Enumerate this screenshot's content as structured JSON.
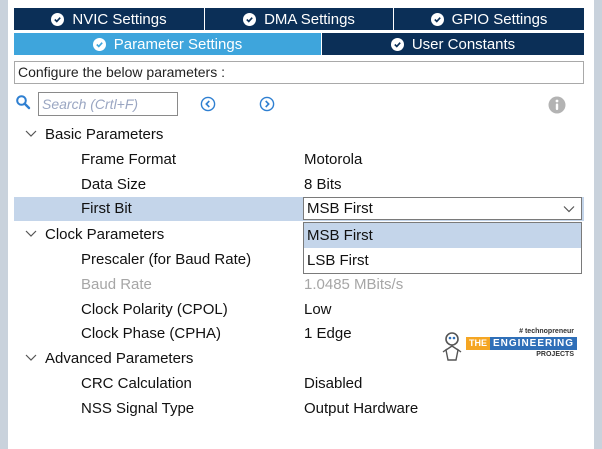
{
  "tabs_top": [
    {
      "label": "NVIC Settings"
    },
    {
      "label": "DMA Settings"
    },
    {
      "label": "GPIO Settings"
    }
  ],
  "tabs_bottom": [
    {
      "label": "Parameter Settings",
      "active": true
    },
    {
      "label": "User Constants",
      "active": false
    }
  ],
  "description": "Configure the below parameters :",
  "search": {
    "placeholder": "Search (Crtl+F)"
  },
  "groups": {
    "basic": {
      "label": "Basic Parameters",
      "params": [
        {
          "label": "Frame Format",
          "value": "Motorola"
        },
        {
          "label": "Data Size",
          "value": "8 Bits"
        },
        {
          "label": "First Bit",
          "value": "MSB First"
        }
      ]
    },
    "clock": {
      "label": "Clock Parameters",
      "params": [
        {
          "label": "Prescaler (for Baud Rate)",
          "value": ""
        },
        {
          "label": "Baud Rate",
          "value": "1.0485 MBits/s"
        },
        {
          "label": "Clock Polarity (CPOL)",
          "value": "Low"
        },
        {
          "label": "Clock Phase (CPHA)",
          "value": "1 Edge"
        }
      ]
    },
    "advanced": {
      "label": "Advanced Parameters",
      "params": [
        {
          "label": "CRC Calculation",
          "value": "Disabled"
        },
        {
          "label": "NSS Signal Type",
          "value": "Output Hardware"
        }
      ]
    }
  },
  "dropdown": {
    "selected": "MSB First",
    "options": [
      "MSB First",
      "LSB First"
    ]
  },
  "watermark": {
    "tagline": "# technopreneur",
    "word1": "THE",
    "word2": "ENGINEERING",
    "word3": "PROJECTS"
  },
  "colors": {
    "tab_dark": "#0b2f57",
    "tab_active": "#3ea5dc",
    "selection": "#c4d5ea"
  }
}
